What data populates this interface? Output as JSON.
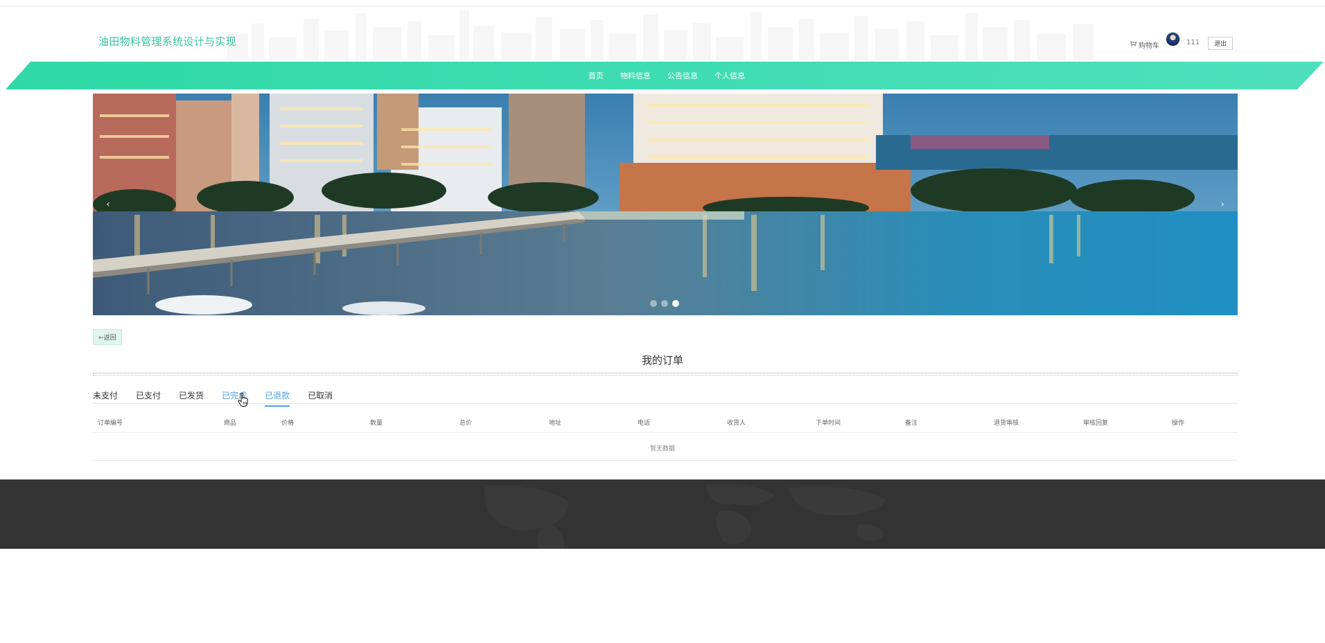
{
  "header": {
    "site_title": "油田物料管理系统设计与实现",
    "cart_label": "购物车",
    "username": "111",
    "logout_label": "退出"
  },
  "nav": {
    "items": [
      {
        "label": "首页"
      },
      {
        "label": "物料信息"
      },
      {
        "label": "公告信息"
      },
      {
        "label": "个人信息"
      }
    ]
  },
  "carousel": {
    "slide_count": 3,
    "active_index": 2,
    "prev_glyph": "‹",
    "next_glyph": "›"
  },
  "page": {
    "back_label": "←返回",
    "title": "我的订单"
  },
  "tabs": [
    {
      "label": "未支付",
      "state": "normal"
    },
    {
      "label": "已支付",
      "state": "normal"
    },
    {
      "label": "已发货",
      "state": "normal"
    },
    {
      "label": "已完成",
      "state": "hover"
    },
    {
      "label": "已退款",
      "state": "active"
    },
    {
      "label": "已取消",
      "state": "normal"
    }
  ],
  "table": {
    "columns": [
      "订单编号",
      "商品",
      "价格",
      "数量",
      "总价",
      "地址",
      "电话",
      "收货人",
      "下单时间",
      "备注",
      "退货审核",
      "审核回复",
      "操作"
    ],
    "empty_text": "暂无数据"
  },
  "colors": {
    "brand": "#36c6a0",
    "nav_gradient_start": "#2fd9a6",
    "nav_gradient_end": "#4fe0bd",
    "active_tab": "#4ea1e6",
    "footer": "#333333"
  }
}
